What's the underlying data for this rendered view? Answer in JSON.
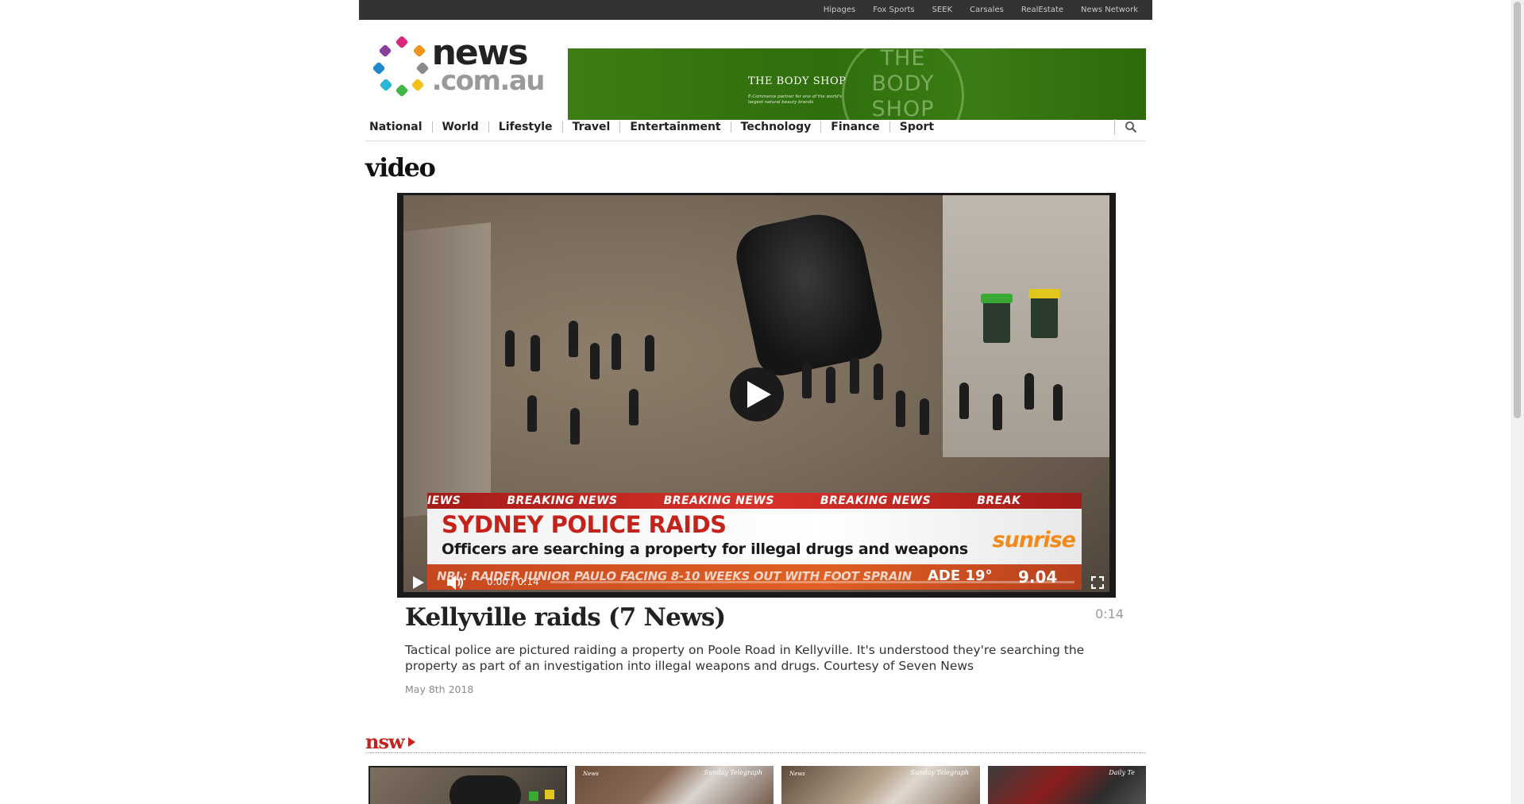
{
  "network_bar": {
    "links": [
      "Hipages",
      "Fox Sports",
      "SEEK",
      "Carsales",
      "RealEstate",
      "News Network"
    ]
  },
  "logo": {
    "line1": "news",
    "line2": ".com.au"
  },
  "ad": {
    "title": "THE BODY SHOP",
    "tagline": "E-Commerce partner for one of the world's largest natural beauty brands",
    "logo_line1": "THE",
    "logo_line2": "BODY",
    "logo_line3": "SHOP"
  },
  "nav": {
    "items": [
      "National",
      "World",
      "Lifestyle",
      "Travel",
      "Entertainment",
      "Technology",
      "Finance",
      "Sport"
    ],
    "search_icon": "search-icon"
  },
  "section_title": "video",
  "player": {
    "overlay": {
      "breaking": [
        "IEWS",
        "BREAKING NEWS",
        "BREAKING NEWS",
        "BREAKING NEWS",
        "BREAK"
      ],
      "headline": "SYDNEY POLICE RAIDS",
      "subheadline": "Officers are searching a property for illegal drugs and weapons",
      "channel": "sunrise",
      "ticker": "NRL: RAIDER JUNIOR PAULO FACING 8-10 WEEKS OUT WITH FOOT SPRAIN",
      "weather": "ADE 19°",
      "clock": "9.04"
    },
    "time_current": "0:00",
    "time_separator": "/",
    "time_total": "0:14",
    "progress": 0,
    "icons": [
      "play-icon",
      "volume-icon",
      "fullscreen-icon"
    ]
  },
  "video": {
    "title": "Kellyville raids (7 News)",
    "duration": "0:14",
    "description": "Tactical police are pictured raiding a property on Poole Road in Kellyville. It's understood they're searching the property as part of an investigation into illegal weapons and drugs. Courtesy of Seven News",
    "date": "May 8th 2018"
  },
  "related": {
    "label": "nsw",
    "thumb_captions": [
      "",
      "Sunday Telegraph",
      "Sunday Telegraph",
      "Daily Te"
    ],
    "thumb_left_captions": [
      "",
      "News",
      "News",
      ""
    ]
  },
  "colors": {
    "brand_red": "#c4231b",
    "topbar": "#333333",
    "ad_green": "#3a7c14"
  }
}
